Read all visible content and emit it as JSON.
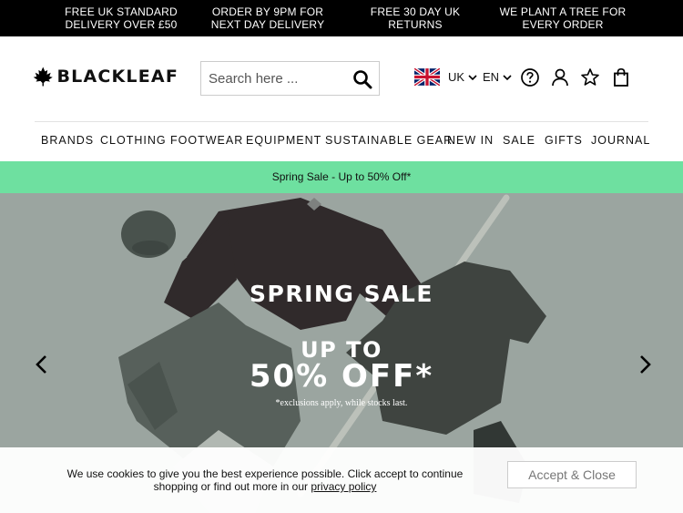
{
  "promos": [
    {
      "line1": "FREE UK STANDARD",
      "line2": "DELIVERY OVER £50"
    },
    {
      "line1": "ORDER BY 9PM FOR",
      "line2": "NEXT DAY DELIVERY"
    },
    {
      "line1": "FREE 30 DAY UK",
      "line2": "RETURNS"
    },
    {
      "line1": "WE PLANT A TREE FOR",
      "line2": "EVERY ORDER"
    }
  ],
  "header": {
    "brand": "BLACKLEAF",
    "search_placeholder": "Search here ...",
    "country": "UK",
    "language": "EN",
    "icons": [
      "maple-leaf-icon",
      "search-icon",
      "uk-flag-icon",
      "chevron-down-icon",
      "help-icon",
      "account-icon",
      "star-icon",
      "bag-icon"
    ]
  },
  "nav": [
    "BRANDS",
    "CLOTHING",
    "FOOTWEAR",
    "EQUIPMENT",
    "SUSTAINABLE GEAR",
    "NEW IN",
    "SALE",
    "GIFTS",
    "JOURNAL"
  ],
  "sale_banner": "Spring Sale - Up to 50% Off*",
  "hero": {
    "headline": "SPRING SALE",
    "sub1": "UP TO",
    "sub2": "50% OFF*",
    "note": "*exclusions apply, while stocks last."
  },
  "cookie": {
    "text_before": "We use cookies to give you the best experience possible. Click accept to continue shopping or find out more in our ",
    "link": "privacy policy",
    "accept_label": "Accept & Close"
  },
  "colors": {
    "topbar": "#000000",
    "sale_banner": "#6ee0a0",
    "hero_bg": "#a8b0ac"
  }
}
